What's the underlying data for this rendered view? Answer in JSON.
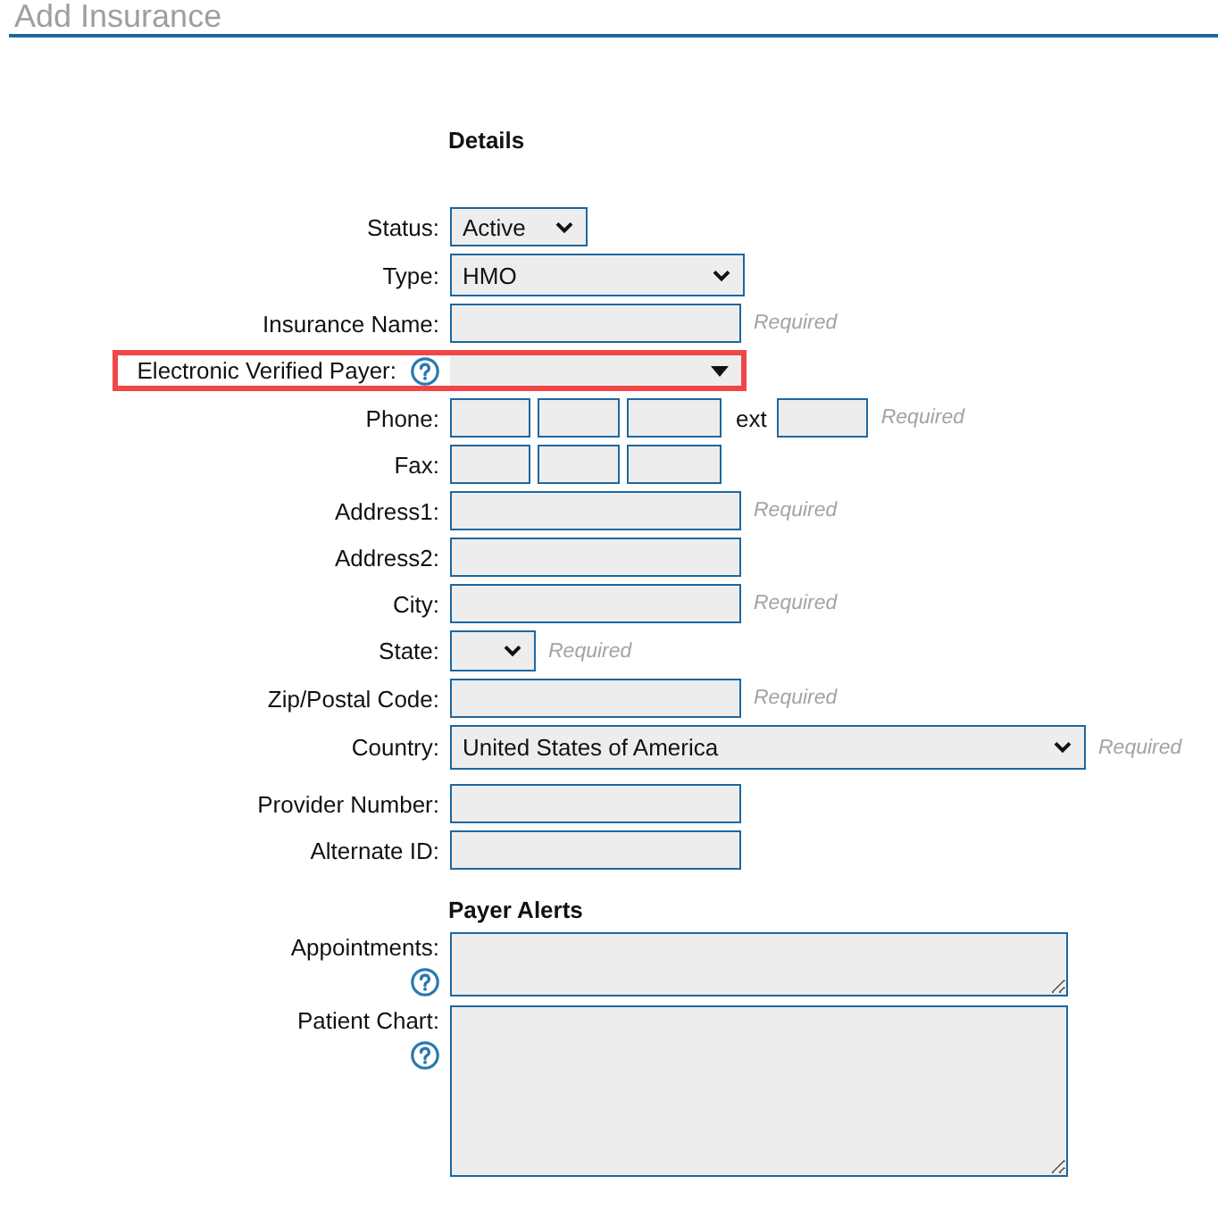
{
  "page": {
    "title": "Add Insurance"
  },
  "sections": [
    {
      "heading": "Details",
      "fields": [
        {
          "kind": "select",
          "label": "Status:",
          "value": "Active",
          "help": false,
          "highlighted": false
        },
        {
          "kind": "select",
          "label": "Type:",
          "value": "HMO",
          "help": false,
          "highlighted": false
        },
        {
          "kind": "text",
          "label": "Insurance Name:",
          "note": "Required",
          "help": false,
          "highlighted": false
        },
        {
          "kind": "combo",
          "label": "Electronic Verified Payer:",
          "help": true,
          "highlighted": true
        },
        {
          "kind": "phone",
          "label": "Phone:",
          "ext": "ext",
          "note": "Required",
          "help": false,
          "highlighted": false
        },
        {
          "kind": "phone",
          "label": "Fax:",
          "help": false,
          "highlighted": false
        },
        {
          "kind": "text",
          "label": "Address1:",
          "note": "Required",
          "help": false,
          "highlighted": false
        },
        {
          "kind": "text",
          "label": "Address2:",
          "help": false,
          "highlighted": false
        },
        {
          "kind": "text",
          "label": "City:",
          "note": "Required",
          "help": false,
          "highlighted": false
        },
        {
          "kind": "select",
          "label": "State:",
          "note": "Required",
          "help": false,
          "highlighted": false
        },
        {
          "kind": "text",
          "label": "Zip/Postal Code:",
          "note": "Required",
          "help": false,
          "highlighted": false
        },
        {
          "kind": "select",
          "label": "Country:",
          "value": "United States of America",
          "note": "Required",
          "help": false,
          "highlighted": false
        },
        {
          "kind": "text",
          "label": "Provider Number:",
          "help": false,
          "highlighted": false
        },
        {
          "kind": "text",
          "label": "Alternate ID:",
          "help": false,
          "highlighted": false
        }
      ]
    },
    {
      "heading": "Payer Alerts",
      "fields": [
        {
          "kind": "textarea",
          "label": "Appointments:",
          "help": true,
          "highlighted": false
        },
        {
          "kind": "textarea",
          "label": "Patient Chart:",
          "help": true,
          "highlighted": false
        }
      ]
    }
  ]
}
